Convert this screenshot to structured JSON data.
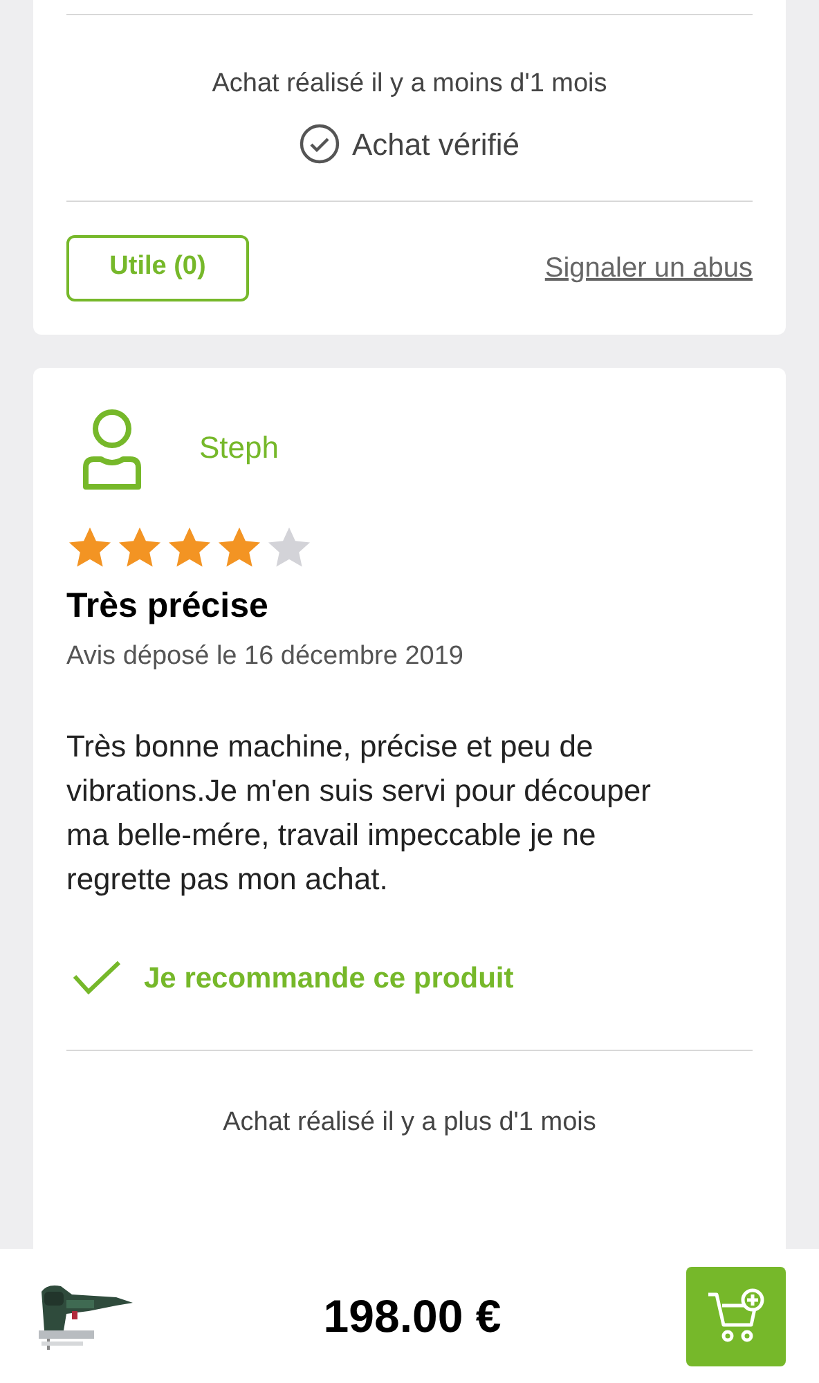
{
  "reviews": [
    {
      "purchase_age": "Achat réalisé il y a moins d'1 mois",
      "verified": true,
      "verified_label": "Achat vérifié",
      "helpful_button": "Utile (0)",
      "report_link": "Signaler un abus"
    },
    {
      "author": "Steph",
      "stars": 4,
      "title": "Très précise",
      "date": "Avis déposé le 16 décembre 2019",
      "body": "Très bonne machine, précise et peu de vibrations.Je m'en suis servi pour découper ma belle-mére, travail impeccable je ne regrette pas mon achat.",
      "recommends": true,
      "recommend_label": "Je recommande ce produit",
      "purchase_age": "Achat réalisé il y a plus d'1 mois"
    }
  ],
  "bottom_bar": {
    "price": "198.00 €"
  }
}
